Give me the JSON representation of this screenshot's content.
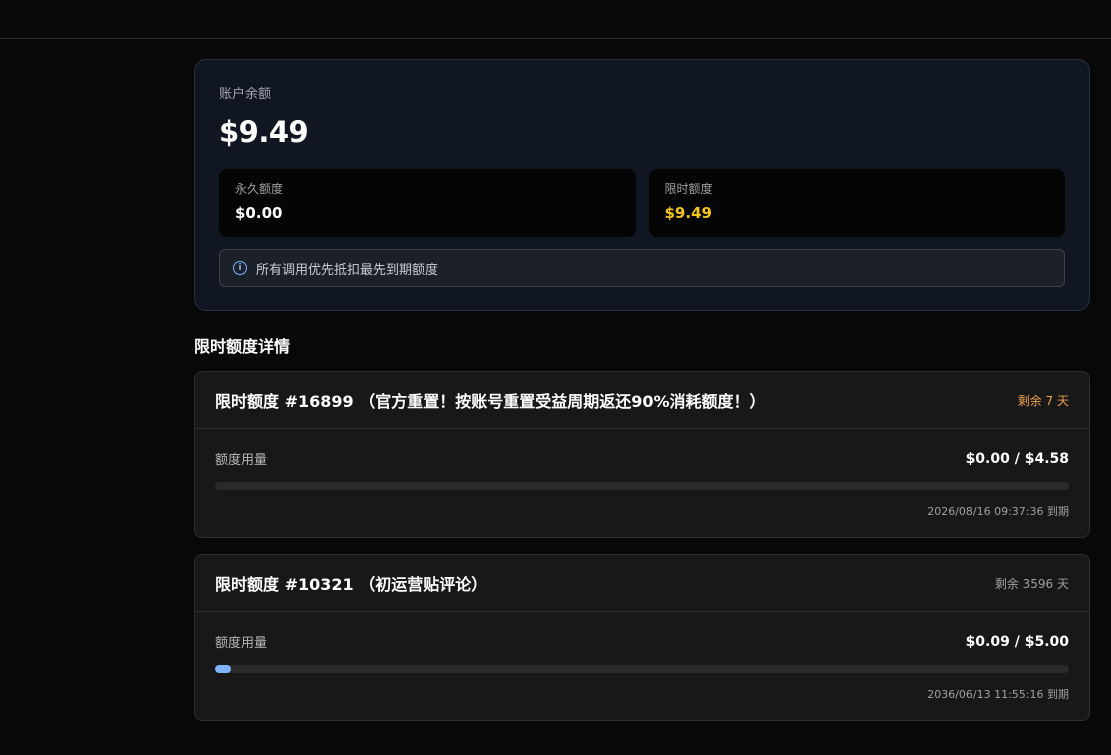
{
  "balance": {
    "label": "账户余额",
    "value": "$9.49",
    "permanent": {
      "label": "永久额度",
      "value": "$0.00"
    },
    "limited": {
      "label": "限时额度",
      "value": "$9.49"
    },
    "info": "所有调用优先抵扣最先到期额度",
    "info_icon": "info-icon"
  },
  "section_title": "限时额度详情",
  "quotas": [
    {
      "title": "限时额度 #16899 （官方重置！按账号重置受益周期返还90%消耗额度！）",
      "remaining": "剩余 7 天",
      "usage_label": "额度用量",
      "usage_value": "$0.00 / $4.58",
      "progress": 0.0,
      "expiry": "2026/08/16 09:37:36 到期"
    },
    {
      "title": "限时额度 #10321 （初运营贴评论）",
      "remaining": "剩余 3596 天",
      "usage_label": "额度用量",
      "usage_value": "$0.09 / $5.00",
      "progress": 0.018,
      "expiry": "2036/06/13 11:55:16 到期"
    }
  ],
  "colors": {
    "accent": "#7fb2ff",
    "gold": "#f5c518",
    "warn": "#f0a050"
  }
}
